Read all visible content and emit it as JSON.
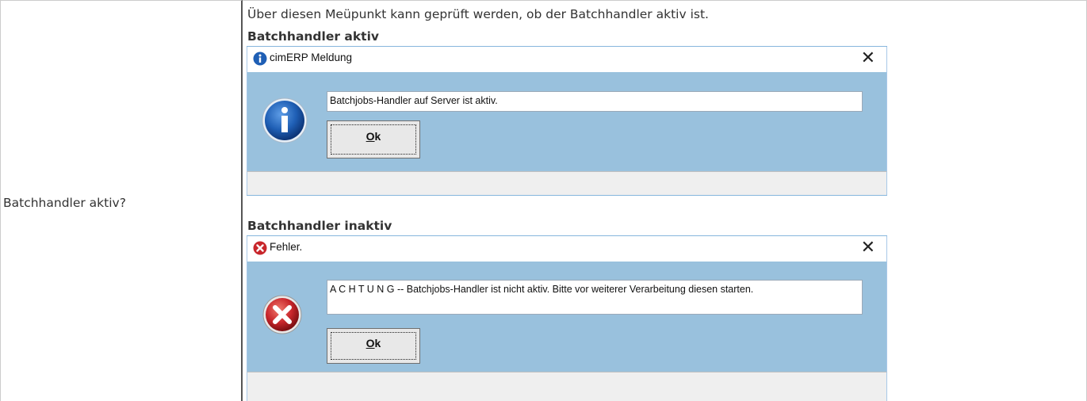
{
  "table": {
    "left_label": "Batchhandler aktiv?",
    "intro": "Über diesen Meüpunkt kann geprüft werden, ob der Batchhandler aktiv ist."
  },
  "sections": [
    {
      "heading": "Batchhandler aktiv",
      "dialog": {
        "title": "cimERP Meldung",
        "title_icon": "info-icon",
        "close_symbol": "✕",
        "big_icon": "info-icon",
        "message": "Batchjobs-Handler auf Server ist aktiv.",
        "ok_first": "O",
        "ok_rest": "k"
      }
    },
    {
      "heading": "Batchhandler inaktiv",
      "dialog": {
        "title": "Fehler.",
        "title_icon": "error-icon",
        "close_symbol": "✕",
        "big_icon": "error-icon",
        "message": "A C H T U N G -- Batchjobs-Handler ist nicht aktiv. Bitte vor weiterer Verarbeitung diesen starten.",
        "ok_first": "O",
        "ok_rest": "k"
      }
    }
  ],
  "colors": {
    "dialog_body": "#99c1dd",
    "info_blue": "#1f5fb5",
    "error_red": "#c8262b"
  }
}
